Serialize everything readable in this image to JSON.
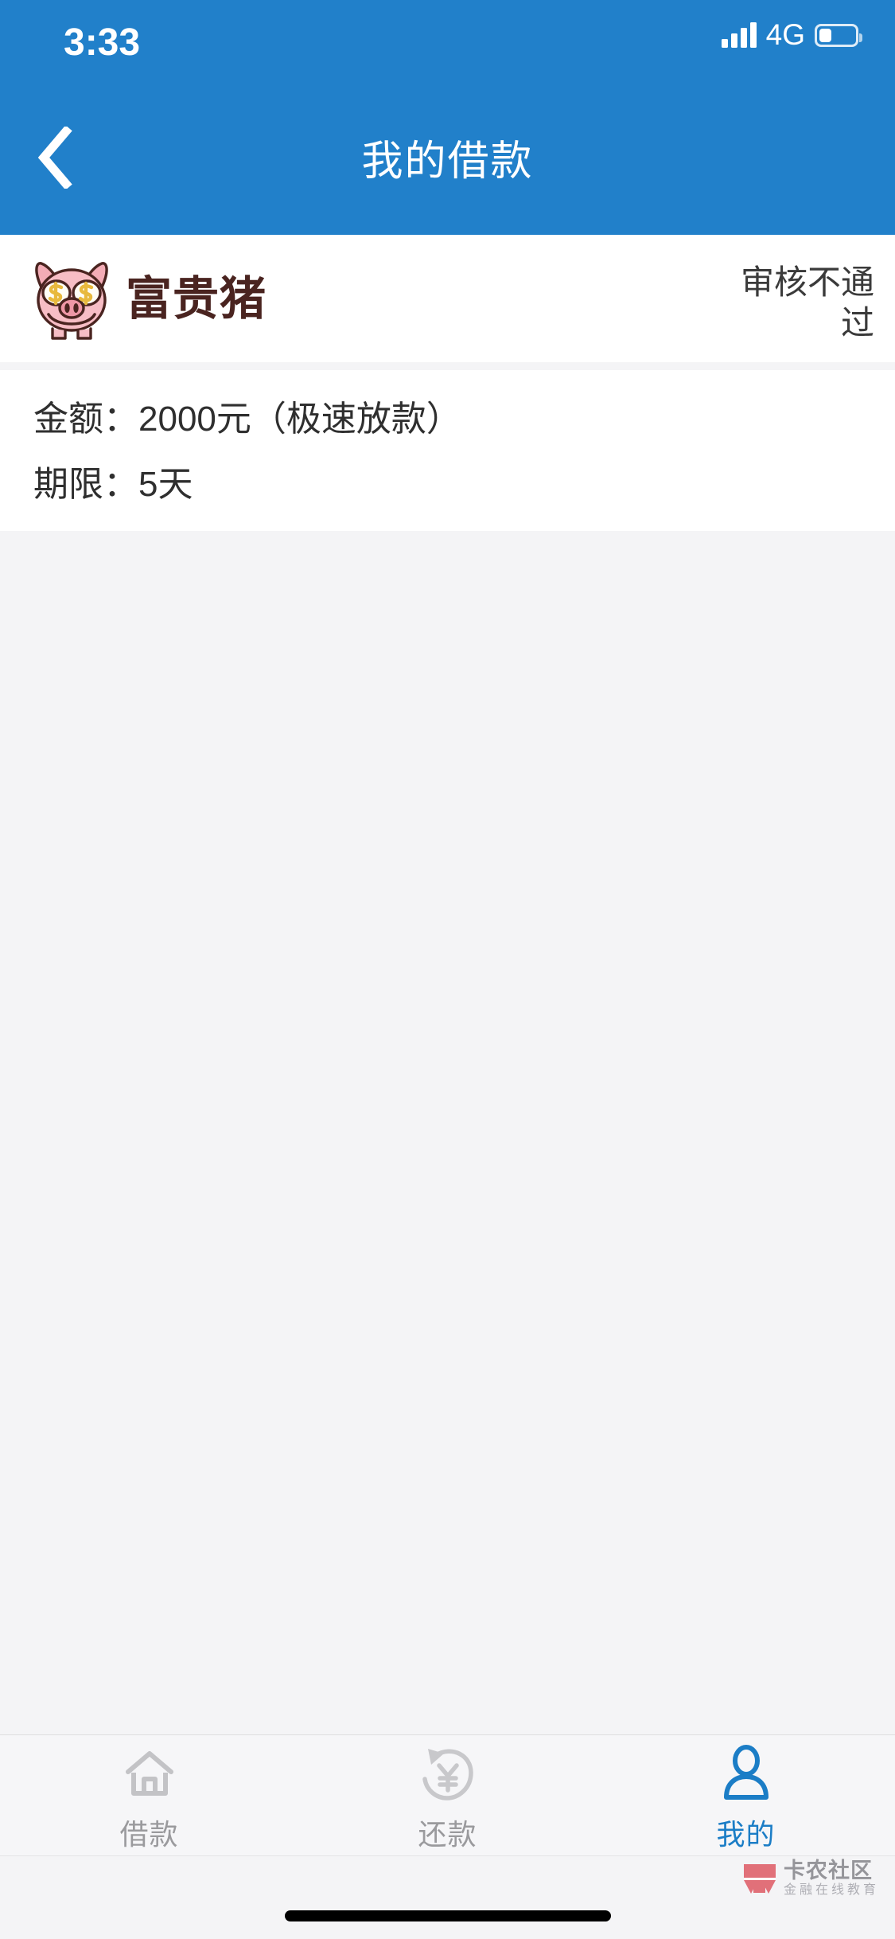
{
  "status_bar": {
    "time": "3:33",
    "network": "4G",
    "signal_icon": "signal-bars-icon",
    "battery_icon": "battery-low-icon"
  },
  "nav": {
    "back_icon": "chevron-left-icon",
    "title": "我的借款"
  },
  "colors": {
    "header_blue": "#2180ca",
    "accent_blue": "#1b7dc6",
    "page_bg": "#f4f4f6",
    "card_bg": "#ffffff",
    "brand_text": "#4a2420",
    "pig_pink": "#f3acb6",
    "pig_outline": "#4a2420",
    "dollar_gold": "#e8b93e",
    "status_gray": "#3a3a3a",
    "tab_inactive": "#9a9a9d"
  },
  "loan_card": {
    "brand": {
      "logo_icon": "pig-money-eyes-logo-icon",
      "name": "富贵猪"
    },
    "status": "审核不通过",
    "details": [
      "金额：2000元（极速放款）",
      "期限：5天"
    ]
  },
  "tabbar": {
    "items": [
      {
        "label": "借款",
        "icon": "home-icon",
        "active": false
      },
      {
        "label": "还款",
        "icon": "refresh-yuan-icon",
        "active": false
      },
      {
        "label": "我的",
        "icon": "person-icon",
        "active": true
      }
    ]
  },
  "watermark": {
    "logo_icon": "kanong-k-logo-icon",
    "main": "卡农社区",
    "sub": "金融在线教育"
  },
  "system": {
    "home_indicator": "home-indicator-bar"
  }
}
